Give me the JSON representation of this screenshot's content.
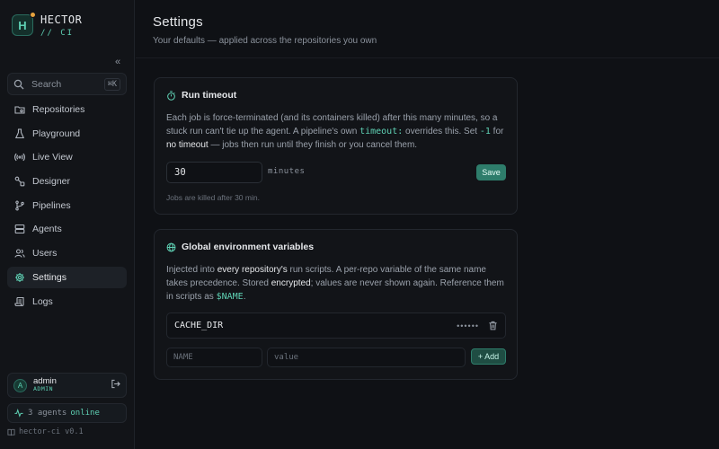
{
  "brand": {
    "logo_letter": "H",
    "name": "HECTOR",
    "sub": "// CI"
  },
  "sidebar": {
    "collapse_glyph": "«",
    "search": {
      "placeholder": "Search",
      "shortcut": "⌘K"
    },
    "items": [
      {
        "label": "Repositories",
        "icon": "repositories-icon"
      },
      {
        "label": "Playground",
        "icon": "flask-icon"
      },
      {
        "label": "Live View",
        "icon": "broadcast-icon"
      },
      {
        "label": "Designer",
        "icon": "designer-icon"
      },
      {
        "label": "Pipelines",
        "icon": "branch-icon"
      },
      {
        "label": "Agents",
        "icon": "server-icon"
      },
      {
        "label": "Users",
        "icon": "users-icon"
      },
      {
        "label": "Settings",
        "icon": "gear-icon",
        "active": true
      },
      {
        "label": "Logs",
        "icon": "scroll-icon"
      }
    ],
    "user": {
      "avatar": "A",
      "name": "admin",
      "role": "ADMIN"
    },
    "agents": {
      "count_text": "3 agents",
      "status": "online"
    },
    "version": "hector-ci v0.1"
  },
  "header": {
    "title": "Settings",
    "subtitle": "Your defaults — applied across the repositories you own"
  },
  "timeout_card": {
    "title": "Run timeout",
    "desc": {
      "p1": "Each job is force-terminated (and its containers killed) after this many minutes, so a stuck run can't tie up the agent. A pipeline's own ",
      "code1": "timeout:",
      "p2": " overrides this. Set ",
      "code2": "-1",
      "p3": " for ",
      "hl1": "no timeout",
      "p4": " — jobs then run until they finish or you cancel them."
    },
    "input_value": "30",
    "unit": "minutes",
    "save_label": "Save",
    "hint": "Jobs are killed after 30 min."
  },
  "env_card": {
    "title": "Global environment variables",
    "desc": {
      "p1": "Injected into ",
      "hl1": "every repository's",
      "p2": " run scripts. A per-repo variable of the same name takes precedence. Stored ",
      "hl2": "encrypted",
      "p3": "; values are never shown again. Reference them in scripts as ",
      "code1": "$NAME",
      "p4": "."
    },
    "variables": [
      {
        "key": "CACHE_DIR",
        "masked": "••••••"
      }
    ],
    "name_placeholder": "NAME",
    "value_placeholder": "value",
    "add_label": "+ Add"
  },
  "colors": {
    "accent": "#5fd1b4",
    "accent_button": "#2e7d6b",
    "background": "#0f1115",
    "warning_dot": "#e7a33e"
  }
}
